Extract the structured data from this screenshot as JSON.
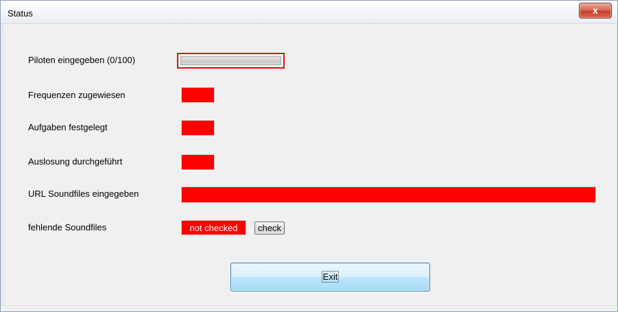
{
  "window": {
    "title": "Status",
    "close_label": "x"
  },
  "rows": {
    "piloten": {
      "label": "Piloten eingegeben (0/100)",
      "progress_fraction": 0.0,
      "status_color": "#ff0000"
    },
    "frequenzen": {
      "label": "Frequenzen zugewiesen",
      "status_color": "#ff0000"
    },
    "aufgaben": {
      "label": "Aufgaben festgelegt",
      "status_color": "#ff0000"
    },
    "auslosung": {
      "label": "Auslosung durchgeführt",
      "status_color": "#ff0000"
    },
    "url": {
      "label": "URL Soundfiles eingegeben",
      "status_color": "#ff0000"
    },
    "soundfiles": {
      "label": "fehlende Soundfiles",
      "status_text": "not checked",
      "check_label": "check",
      "status_color": "#ff0000"
    }
  },
  "buttons": {
    "exit_label": "Exit"
  },
  "colors": {
    "error": "#ff0000",
    "window_bg": "#f0f0f0"
  }
}
